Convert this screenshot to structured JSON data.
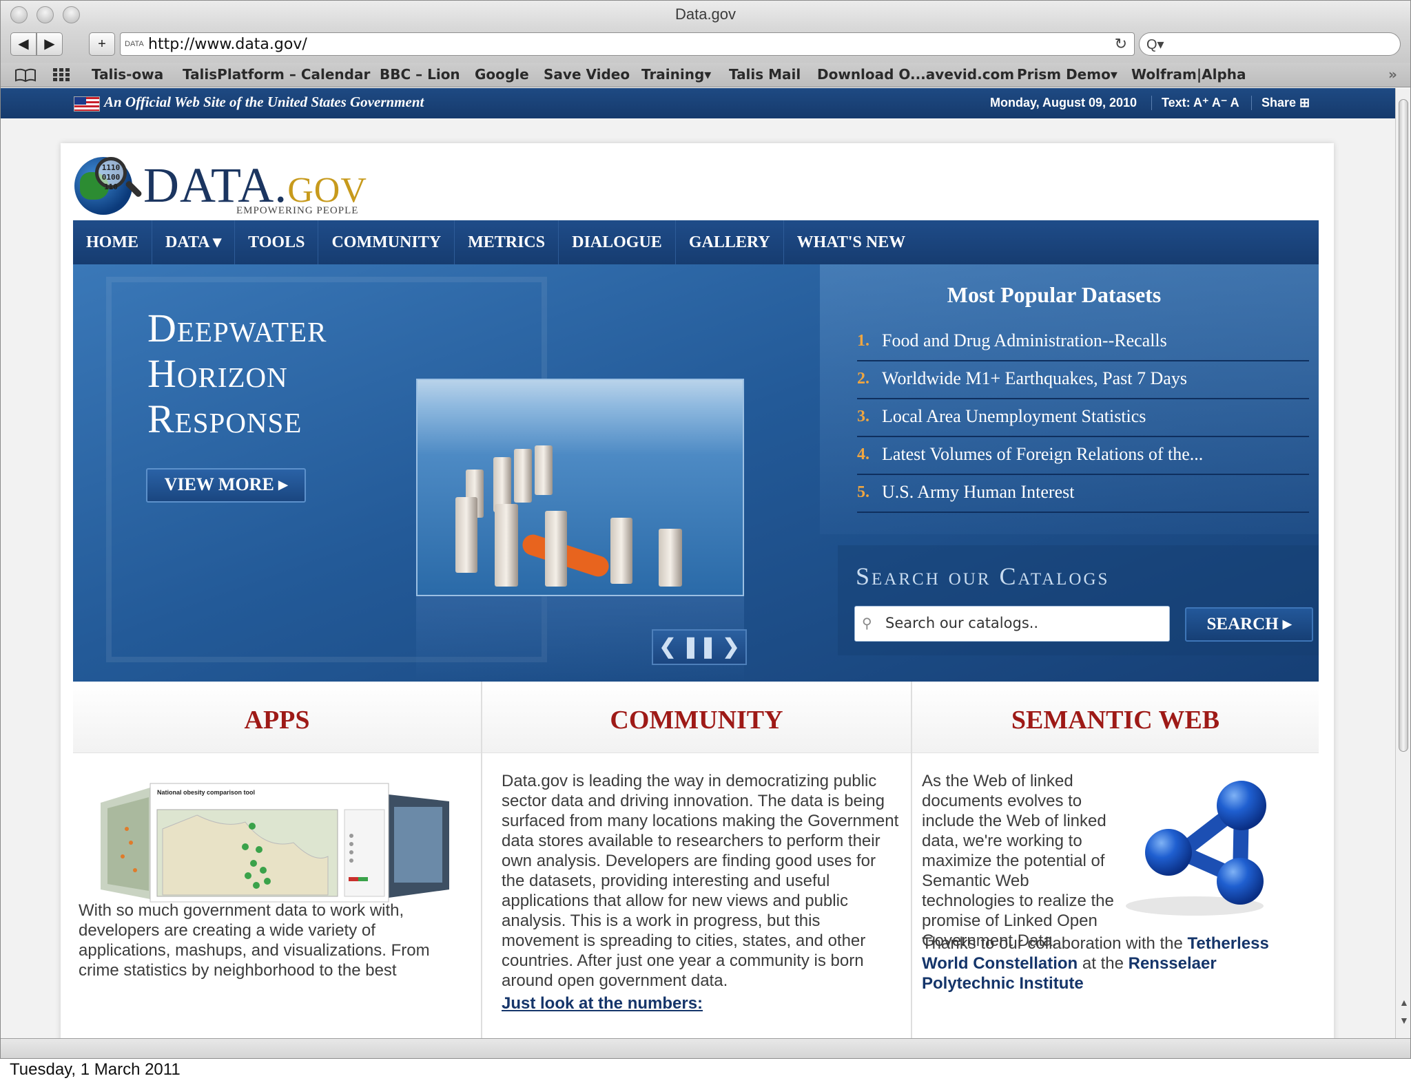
{
  "window": {
    "title": "Data.gov"
  },
  "toolbar": {
    "back_icon": "◀",
    "forward_icon": "▶",
    "add_icon": "+",
    "favicon_text": "DATA",
    "url": "http://www.data.gov/",
    "reload_icon": "↻",
    "search_icon": "Q▾"
  },
  "bookmarks": [
    "Talis-owa",
    "TalisPlatform – Calendar",
    "BBC – Lion",
    "Google",
    "Save Video",
    "Training▾",
    "Talis Mail",
    "Download O...avevid.com",
    "Prism Demo▾",
    "Wolfram|Alpha"
  ],
  "bookmarks_overflow": "»",
  "govbar": {
    "official_text": "An Official Web Site of the United States Government",
    "date": "Monday, August 09, 2010",
    "text_size": "Text: A⁺ A⁻ A",
    "share": "Share ⊞"
  },
  "logo": {
    "lens_text": "1110\n0100\n110",
    "main": "DATA.",
    "gov": "GOV",
    "tagline": "EMPOWERING PEOPLE"
  },
  "nav": [
    "HOME",
    "DATA ▾",
    "TOOLS",
    "COMMUNITY",
    "METRICS",
    "DIALOGUE",
    "GALLERY",
    "WHAT'S NEW"
  ],
  "hero": {
    "title_lines": [
      "Deepwater",
      "Horizon",
      "Response"
    ],
    "button": "VIEW MORE ▸",
    "controls": [
      "❮",
      "❚❚",
      "❯"
    ]
  },
  "popular": {
    "title": "Most Popular Datasets",
    "items": [
      {
        "num": "1.",
        "label": "Food and Drug Administration--Recalls"
      },
      {
        "num": "2.",
        "label": "Worldwide M1+ Earthquakes, Past 7 Days"
      },
      {
        "num": "3.",
        "label": "Local Area Unemployment Statistics"
      },
      {
        "num": "4.",
        "label": "Latest Volumes of Foreign Relations of the..."
      },
      {
        "num": "5.",
        "label": "U.S. Army Human Interest"
      }
    ]
  },
  "catalog_search": {
    "title": "Search our Catalogs",
    "placeholder": "Search our catalogs..",
    "button": "SEARCH ▸"
  },
  "apps": {
    "title": "APPS",
    "img_title": "National obesity comparison tool",
    "text": "With so much government data to work with, developers are creating a wide variety of applications, mashups, and visualizations. From crime statistics by neighborhood to the best"
  },
  "community": {
    "title": "COMMUNITY",
    "text": "Data.gov is leading the way in democratizing public sector data and driving innovation. The data is being surfaced from many locations making the Government data stores available to researchers to perform their own analysis. Developers are finding good uses for the datasets, providing interesting and useful applications that allow for new views and public analysis. This is a work in progress, but this movement is spreading to cities, states, and other countries. After just one year a community is born around open government data.",
    "link": "Just look at the numbers:"
  },
  "semantic": {
    "title": "SEMANTIC WEB",
    "text": "As the Web of linked documents evolves to include the Web of linked data, we're working to maximize the potential of Semantic Web technologies to realize the promise of Linked Open Government Data.",
    "text2_pre": "Thanks to our collaboration with the ",
    "link1": "Tetherless World Constellation",
    "text2_mid": " at the ",
    "link2": "Rensselaer",
    "link2_cont": "Polytechnic Institute"
  },
  "caption": "Tuesday, 1 March 2011"
}
